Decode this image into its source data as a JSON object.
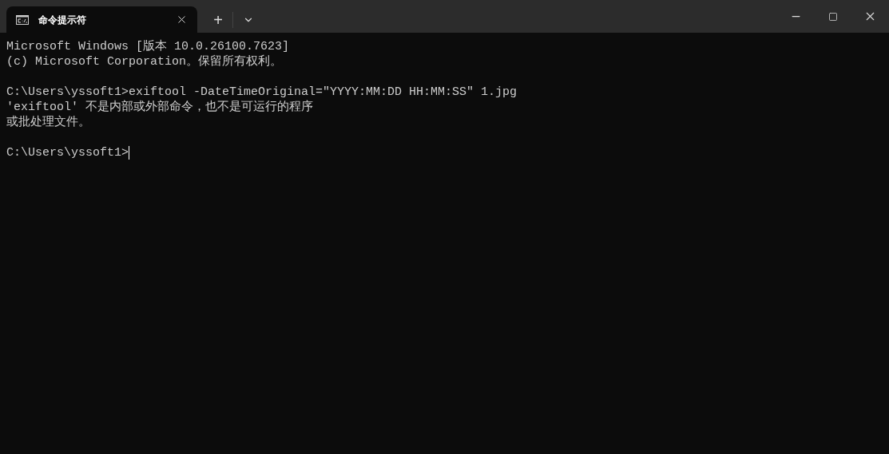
{
  "tabs": [
    {
      "title": "命令提示符",
      "selected": true
    }
  ],
  "tab_bar": {
    "new_tab": "+"
  },
  "console": {
    "blocks": [
      {
        "lines": [
          {
            "text": "Microsoft Windows [版本 10.0.26100.7623]",
            "cursor": false
          },
          {
            "text": "(c) Microsoft Corporation。保留所有权利。",
            "cursor": false
          }
        ]
      },
      {
        "lines": [
          {
            "text": "C:\\Users\\yssoft1>exiftool -DateTimeOriginal=\"YYYY:MM:DD HH:MM:SS\" 1.jpg",
            "cursor": false
          },
          {
            "text": "'exiftool' 不是内部或外部命令，也不是可运行的程序",
            "cursor": false
          },
          {
            "text": "或批处理文件。",
            "cursor": false
          }
        ]
      },
      {
        "lines": [
          {
            "text": "C:\\Users\\yssoft1>",
            "cursor": true
          }
        ]
      }
    ]
  }
}
